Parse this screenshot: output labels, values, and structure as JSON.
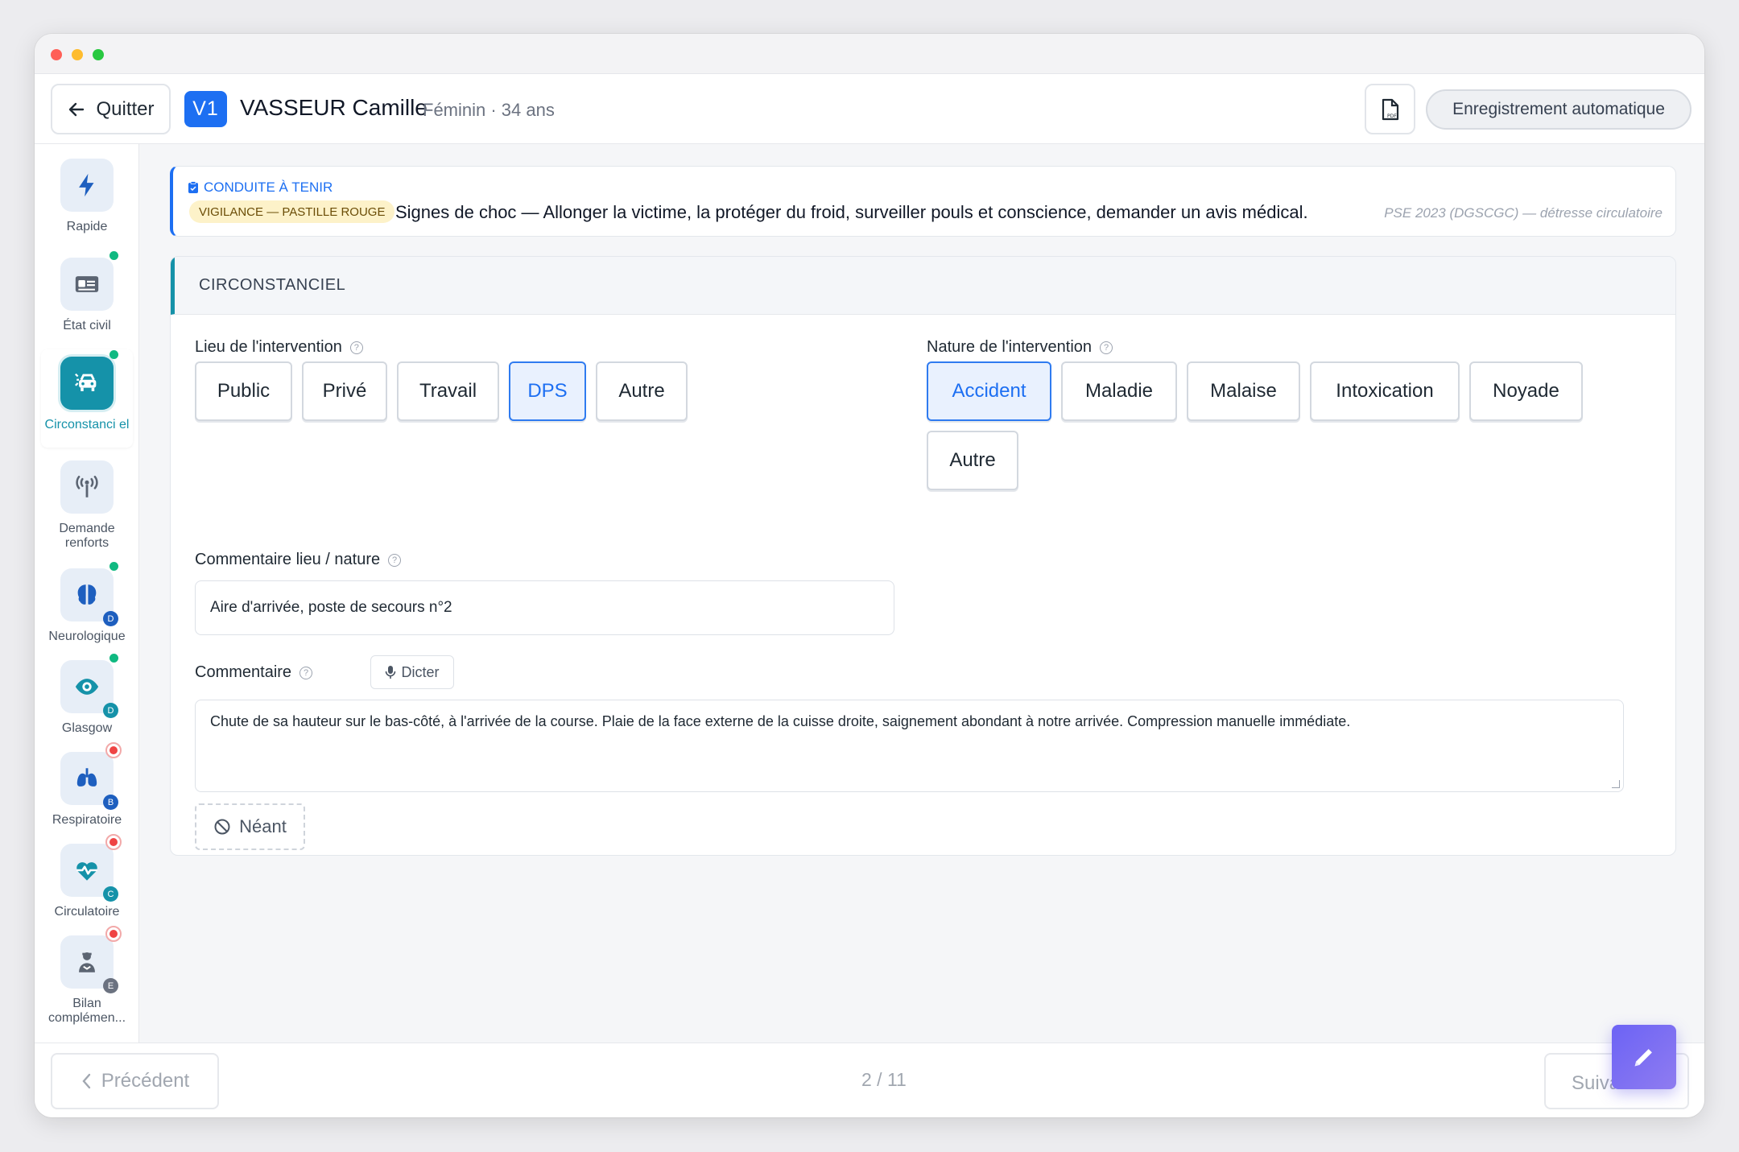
{
  "header": {
    "quit_label": "Quitter",
    "avatar_initials": "V1",
    "patient_name": "VASSEUR Camille",
    "patient_meta": "Féminin · 34 ans",
    "autosave_label": "Enregistrement automatique"
  },
  "sidebar": {
    "items": [
      {
        "label": "Rapide",
        "icon": "bolt-icon"
      },
      {
        "label": "État civil",
        "icon": "id-card-icon",
        "status": "green"
      },
      {
        "label": "Circonstanci el",
        "icon": "car-crash-icon",
        "status": "green",
        "active": true
      },
      {
        "label": "Demande renforts",
        "icon": "antenna-icon"
      },
      {
        "label": "Neurologique",
        "icon": "brain-icon",
        "status": "green",
        "badge": "D"
      },
      {
        "label": "Glasgow",
        "icon": "eye-icon",
        "status": "green",
        "badge": "D"
      },
      {
        "label": "Respiratoire",
        "icon": "lungs-icon",
        "status": "red",
        "badge": "B"
      },
      {
        "label": "Circulatoire",
        "icon": "heart-pulse-icon",
        "status": "red",
        "badge": "C"
      },
      {
        "label": "Bilan complémen...",
        "icon": "person-icon",
        "status": "red",
        "badge": "E"
      }
    ]
  },
  "alert": {
    "title": "CONDUITE À TENIR",
    "badge": "VIGILANCE — PASTILLE ROUGE",
    "text": "Signes de choc — Allonger la victime, la protéger du froid, surveiller pouls et conscience, demander un avis médical.",
    "source": "PSE 2023 (DGSCGC) — détresse circulatoire"
  },
  "section": {
    "title": "CIRCONSTANCIEL",
    "lieu_label": "Lieu de l'intervention",
    "lieu_options": [
      "Public",
      "Privé",
      "Travail",
      "DPS",
      "Autre"
    ],
    "lieu_selected": "DPS",
    "nature_label": "Nature de l'intervention",
    "nature_options": [
      "Accident",
      "Maladie",
      "Malaise",
      "Intoxication",
      "Noyade",
      "Autre"
    ],
    "nature_selected": "Accident",
    "comment_lieu_label": "Commentaire lieu / nature",
    "comment_lieu_value": "Aire d'arrivée, poste de secours n°2",
    "comment_label": "Commentaire",
    "dictate_label": "Dicter",
    "comment_value": "Chute de sa hauteur sur le bas-côté, à l'arrivée de la course. Plaie de la face externe de la cuisse droite, saignement abondant à notre arrivée. Compression manuelle immédiate.",
    "neant_label": "Néant"
  },
  "footer": {
    "prev_label": "Précédent",
    "pager": "2 / 11",
    "next_label": "Suivant"
  },
  "colors": {
    "primary": "#1d6ff2",
    "teal": "#1592a9",
    "fab": "#6c63f5"
  }
}
